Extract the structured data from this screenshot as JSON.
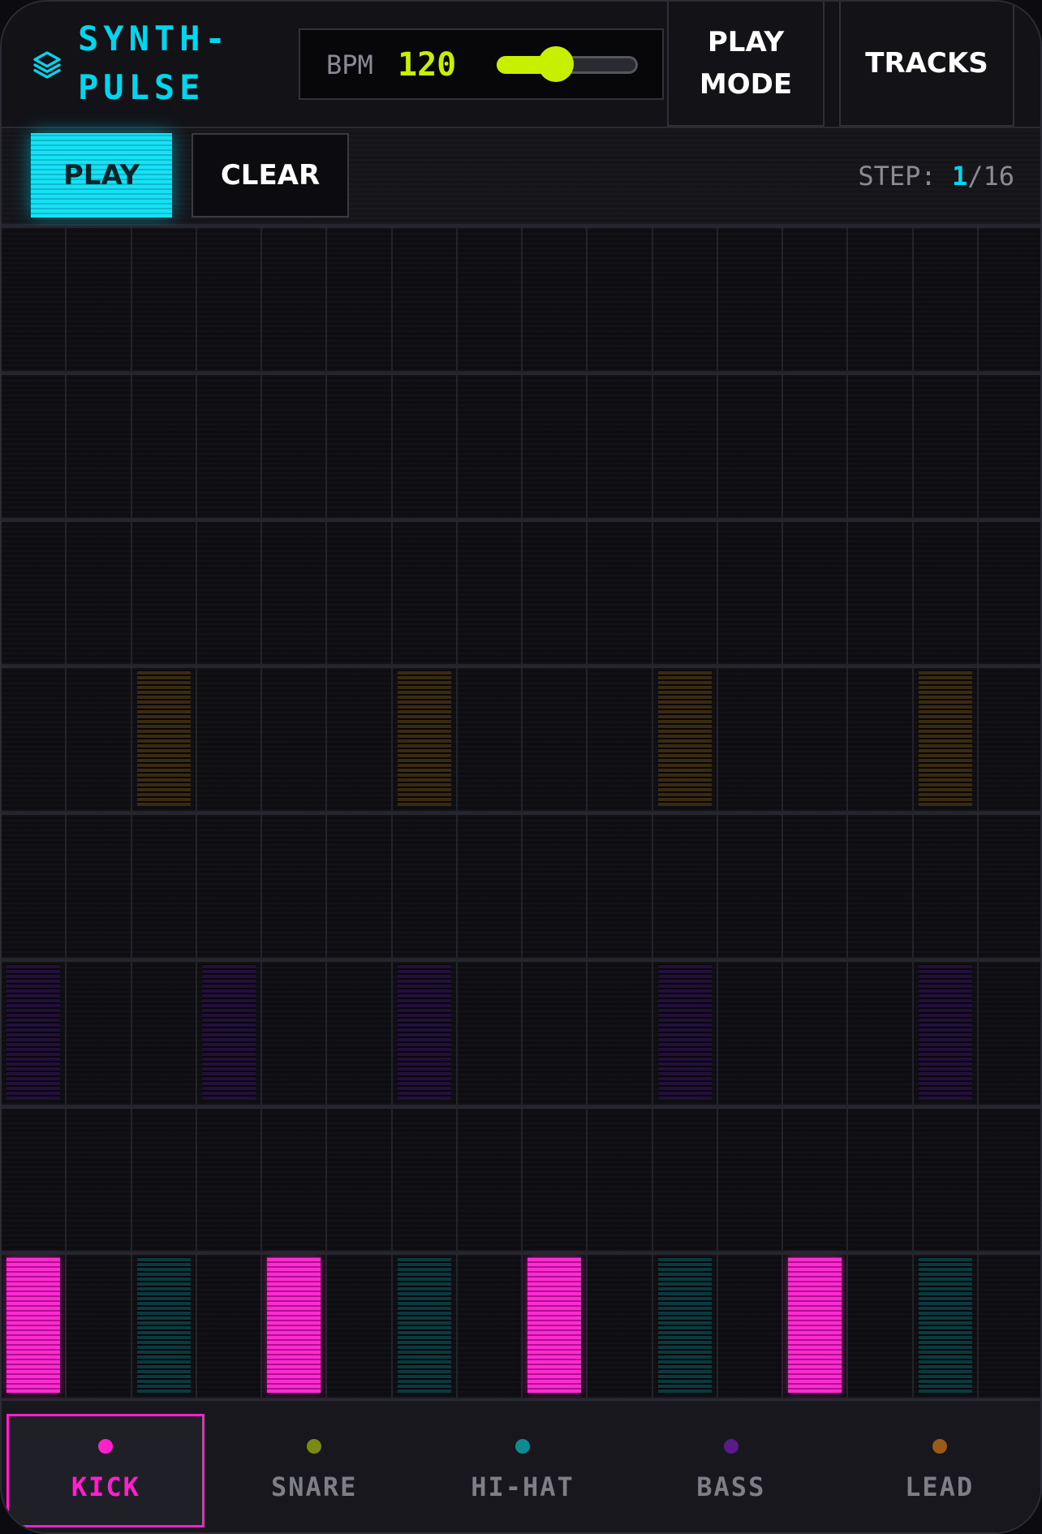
{
  "app": {
    "title": "SYNTH-PULSE",
    "title_lines": [
      "SYNTH-",
      "PULSE"
    ],
    "logo_icon": "layers-icon"
  },
  "colors": {
    "accent_cyan": "#00d6ee",
    "accent_lime": "#c6f000",
    "kick": "#ff1fcd",
    "snare": "#7a8a12",
    "hihat": "#0e8a93",
    "bass": "#5a1a8a",
    "lead": "#9a5a1a"
  },
  "bpm": {
    "label": "BPM",
    "value": "120",
    "slider_fraction": 0.42
  },
  "header_buttons": {
    "play_mode": "PLAY\nMODE",
    "tracks": "TRACKS"
  },
  "controls": {
    "play_label": "PLAY",
    "clear_label": "CLEAR",
    "step_label": "STEP:",
    "step_current": "1",
    "step_total": "/16"
  },
  "sequencer": {
    "rows": 8,
    "steps": 16,
    "row_order_top_to_bottom": [
      "row1",
      "row2",
      "row3",
      "lead",
      "row5",
      "bass",
      "row7",
      "kick-hihat"
    ],
    "active_cells": [
      {
        "row": 3,
        "step": 3,
        "color": "#3a2a10",
        "kind": "lead"
      },
      {
        "row": 3,
        "step": 7,
        "color": "#3a2a10",
        "kind": "lead"
      },
      {
        "row": 3,
        "step": 11,
        "color": "#3a2a10",
        "kind": "lead"
      },
      {
        "row": 3,
        "step": 15,
        "color": "#3a2a10",
        "kind": "lead"
      },
      {
        "row": 5,
        "step": 1,
        "color": "#23103a",
        "kind": "bass"
      },
      {
        "row": 5,
        "step": 4,
        "color": "#23103a",
        "kind": "bass"
      },
      {
        "row": 5,
        "step": 7,
        "color": "#23103a",
        "kind": "bass"
      },
      {
        "row": 5,
        "step": 11,
        "color": "#23103a",
        "kind": "bass"
      },
      {
        "row": 5,
        "step": 15,
        "color": "#23103a",
        "kind": "bass"
      },
      {
        "row": 7,
        "step": 1,
        "color": "#ff1fcd",
        "kind": "kick"
      },
      {
        "row": 7,
        "step": 3,
        "color": "#0b3a3e",
        "kind": "hihat"
      },
      {
        "row": 7,
        "step": 5,
        "color": "#ff1fcd",
        "kind": "kick"
      },
      {
        "row": 7,
        "step": 7,
        "color": "#0b3a3e",
        "kind": "hihat"
      },
      {
        "row": 7,
        "step": 9,
        "color": "#ff1fcd",
        "kind": "kick"
      },
      {
        "row": 7,
        "step": 11,
        "color": "#0b3a3e",
        "kind": "hihat"
      },
      {
        "row": 7,
        "step": 13,
        "color": "#ff1fcd",
        "kind": "kick"
      },
      {
        "row": 7,
        "step": 15,
        "color": "#0b3a3e",
        "kind": "hihat"
      }
    ]
  },
  "tabs": [
    {
      "label": "KICK",
      "dot_color": "#ff1fcd",
      "active": true
    },
    {
      "label": "SNARE",
      "dot_color": "#7a8a12",
      "active": false
    },
    {
      "label": "HI-HAT",
      "dot_color": "#0e8a93",
      "active": false
    },
    {
      "label": "BASS",
      "dot_color": "#5a1a8a",
      "active": false
    },
    {
      "label": "LEAD",
      "dot_color": "#9a5a1a",
      "active": false
    }
  ]
}
